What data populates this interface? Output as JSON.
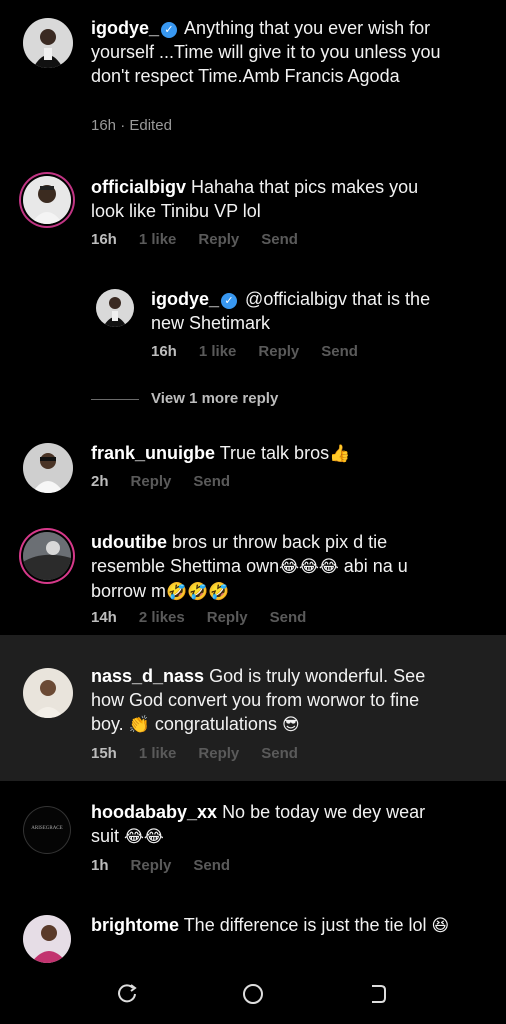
{
  "comments": [
    {
      "user": "igodye_",
      "verified": true,
      "text": "Anything that you ever wish for yourself ...Time will give it to you unless you don't respect Time.Amb Francis Agoda",
      "time": "16h",
      "extra": "Edited"
    },
    {
      "user": "officialbigv",
      "text": "Hahaha that pics makes you look like Tinibu VP lol",
      "time": "16h",
      "likes": "1 like",
      "reply": "Reply",
      "send": "Send"
    },
    {
      "user": "igodye_",
      "verified": true,
      "text": "@officialbigv  that is the new Shetimark",
      "time": "16h",
      "likes": "1 like",
      "reply": "Reply",
      "send": "Send"
    },
    {
      "user": "frank_unuigbe",
      "text": "True talk bros",
      "emoji": "👍",
      "time": "2h",
      "reply": "Reply",
      "send": "Send"
    },
    {
      "user": "udoutibe",
      "text": "bros ur throw back pix d tie resemble Shettima own",
      "emoji1": "😂😂😂",
      "text2": " abi na u borrow m",
      "emoji2": "🤣🤣🤣",
      "time": "14h",
      "likes": "2 likes",
      "reply": "Reply",
      "send": "Send"
    },
    {
      "user": "nass_d_nass",
      "text": "God is truly wonderful. See how God convert you from worwor to fine boy.",
      "emoji1": "👏",
      "text2": " congratulations ",
      "emoji2": "😎",
      "time": "15h",
      "likes": "1 like",
      "reply": "Reply",
      "send": "Send"
    },
    {
      "user": "hoodababy_xx",
      "text": "No be today we dey wear suit ",
      "emoji": "😂😂",
      "time": "1h",
      "reply": "Reply",
      "send": "Send",
      "avatar_text": "ARISEGRACE"
    },
    {
      "user": "brightome",
      "text": "The difference is just the tie lol ",
      "emoji": "😆"
    }
  ],
  "view_more": "View 1 more reply",
  "colors": {
    "verified": "#3897f0",
    "story_ring": "#c13584",
    "highlight_bg": "#1f1f1f"
  },
  "nav": {
    "recent": "recent-apps-icon",
    "home": "home-icon",
    "back": "back-icon"
  }
}
